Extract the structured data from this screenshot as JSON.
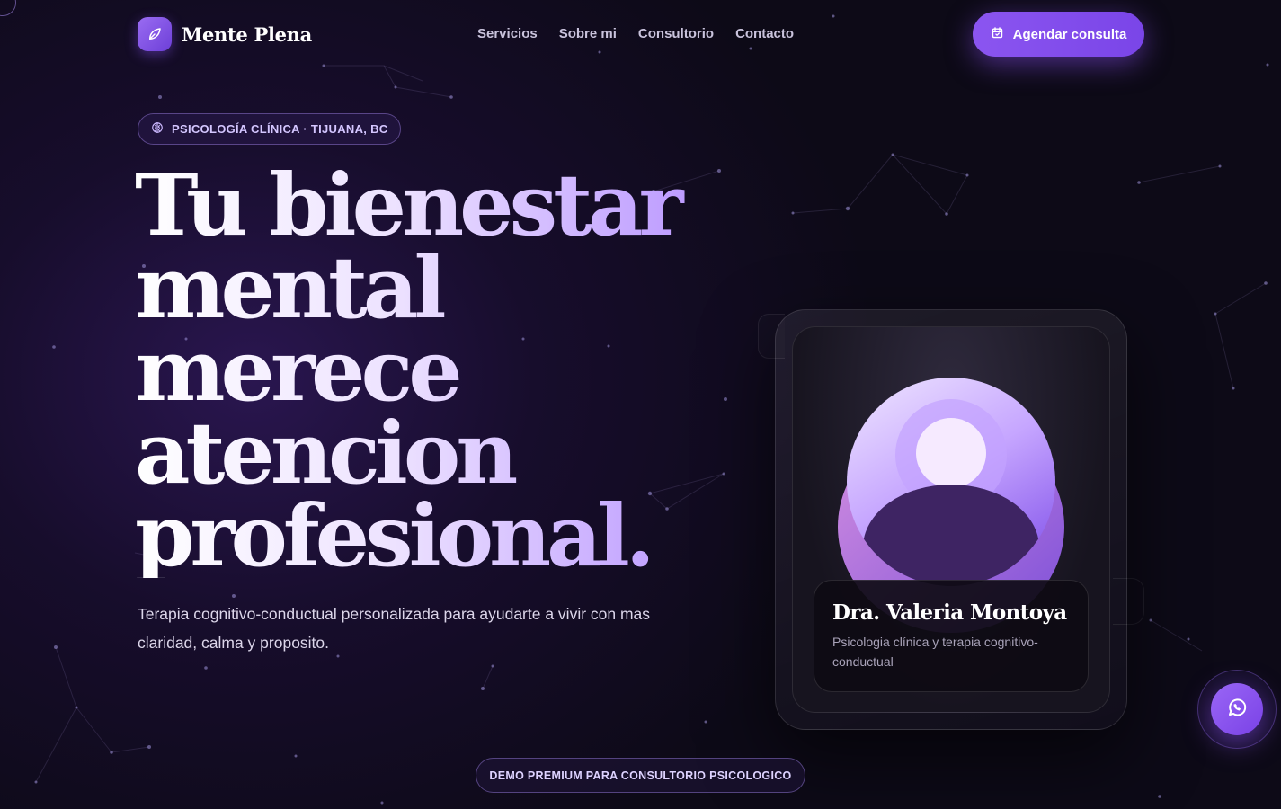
{
  "brand": {
    "name": "Mente Plena"
  },
  "nav": {
    "links": [
      "Servicios",
      "Sobre mi",
      "Consultorio",
      "Contacto"
    ],
    "cta_label": "Agendar consulta"
  },
  "hero": {
    "badge": "PSICOLOGÍA CLÍNICA · TIJUANA, BC",
    "title_lines": [
      "Tu bienestar",
      "mental",
      "merece",
      "atencion",
      "profesional."
    ],
    "subtitle": "Terapia cognitivo-conductual personalizada para ayudarte a vivir con mas claridad, calma y proposito."
  },
  "profile_card": {
    "name": "Dra. Valeria Montoya",
    "role": "Psicologia clínica y terapia cognitivo-conductual"
  },
  "footer_pill": "DEMO PREMIUM PARA CONSULTORIO PSICOLOGICO",
  "colors": {
    "accent": "#8b55f0",
    "accent_light": "#b996ff",
    "background": "#0d0a17"
  },
  "icons": {
    "logo": "leaf-icon",
    "cta": "calendar-icon",
    "badge": "brain-icon",
    "floating": "whatsapp-icon"
  }
}
